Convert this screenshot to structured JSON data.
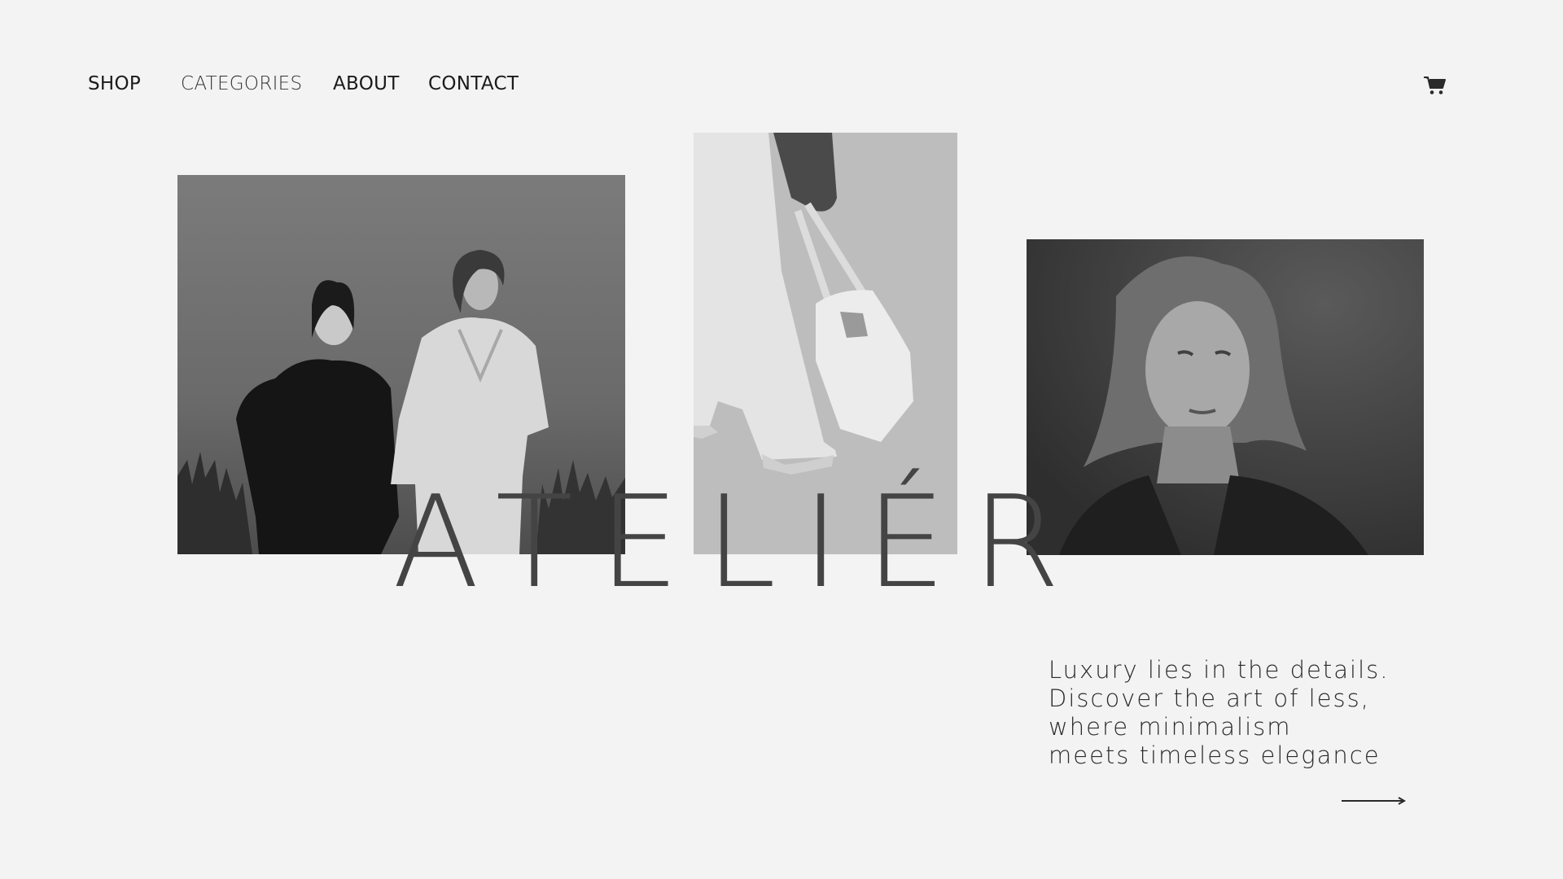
{
  "nav": {
    "items": [
      {
        "label": "SHOP"
      },
      {
        "label": "CATEGORIES"
      },
      {
        "label": "ABOUT"
      },
      {
        "label": "CONTACT"
      }
    ],
    "cart_icon": "shopping-cart-icon"
  },
  "brand": {
    "name": "ATELIÉR"
  },
  "photos": [
    {
      "description": "two-models-in-field-photo"
    },
    {
      "description": "tote-bag-detail-photo"
    },
    {
      "description": "woman-portrait-photo"
    }
  ],
  "tagline": {
    "lines": [
      "Luxury lies in the details.",
      "Discover the art of less,",
      "where minimalism",
      "meets timeless elegance"
    ]
  },
  "cta": {
    "icon": "arrow-right-icon"
  },
  "colors": {
    "background": "#f3f3f3",
    "text": "#1a1a1a",
    "brand": "#444444"
  }
}
